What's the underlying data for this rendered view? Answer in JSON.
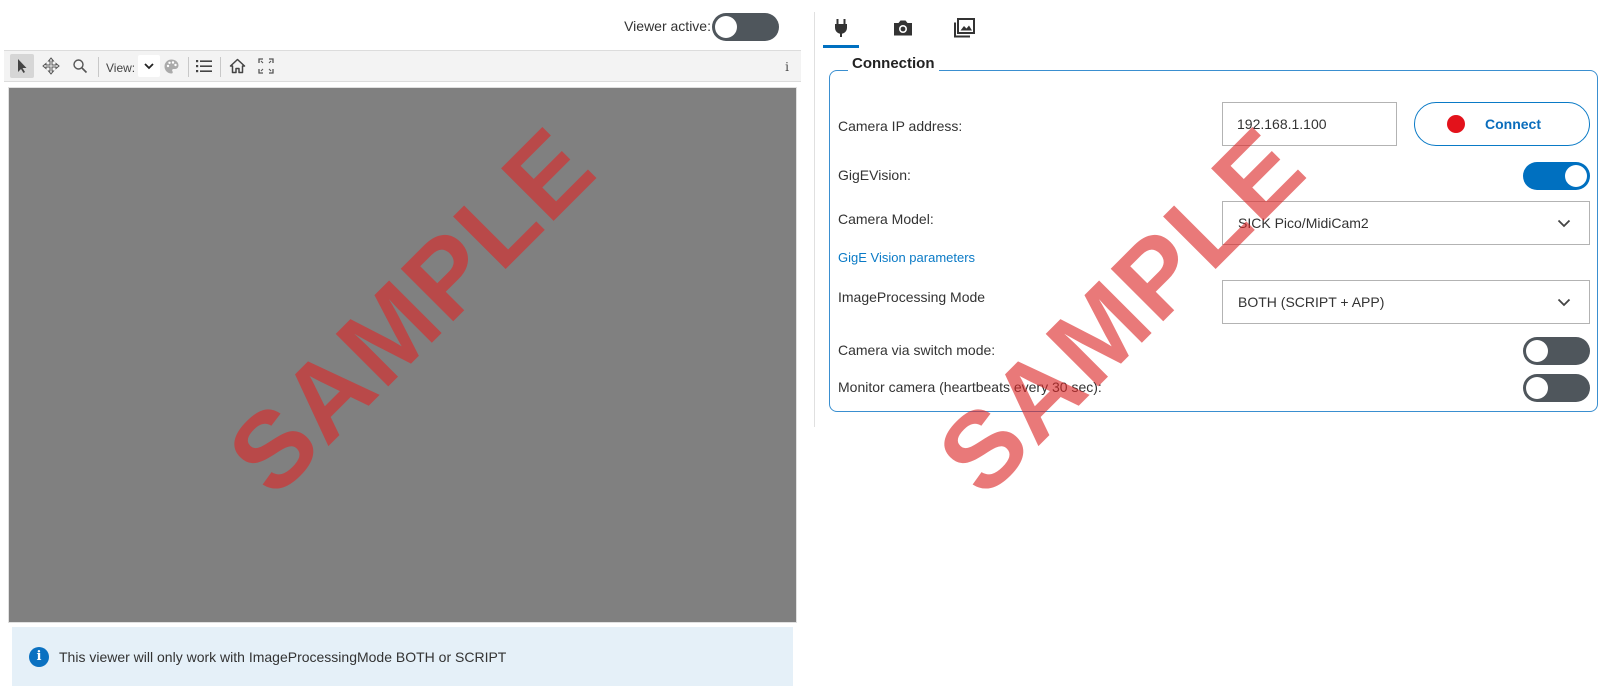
{
  "viewer": {
    "active_label": "Viewer active:",
    "active_on": false,
    "toolbar": {
      "view_label": "View:",
      "info_label": "i",
      "icons": [
        "pointer-icon",
        "pan-icon",
        "zoom-icon",
        "chevron-down-icon",
        "palette-icon",
        "list-icon",
        "home-icon",
        "fit-screen-icon"
      ]
    },
    "info_banner": {
      "icon": "info-icon",
      "text": "This viewer will only work with ImageProcessingMode BOTH or SCRIPT"
    }
  },
  "tabs": [
    {
      "icon": "plug-icon",
      "active": true
    },
    {
      "icon": "camera-icon",
      "active": false
    },
    {
      "icon": "images-icon",
      "active": false
    }
  ],
  "connection": {
    "title": "Connection",
    "ip_label": "Camera IP address:",
    "ip_value": "192.168.1.100",
    "connect_label": "Connect",
    "connect_status_color": "#e3121b",
    "gige_label": "GigEVision:",
    "gige_on": true,
    "model_label": "Camera Model:",
    "model_value": "SICK Pico/MidiCam2",
    "gige_params_link": "GigE Vision parameters",
    "mode_label": "ImageProcessing Mode",
    "mode_value": "BOTH (SCRIPT + APP)",
    "switch_mode_label": "Camera via switch mode:",
    "switch_mode_on": false,
    "monitor_label": "Monitor camera (heartbeats every 30 sec):",
    "monitor_on": false
  },
  "watermark": "SAMPLE",
  "colors": {
    "accent": "#0070c0",
    "toggle_off": "#4f565c",
    "canvas": "#808080",
    "banner": "#e5f0f8"
  }
}
